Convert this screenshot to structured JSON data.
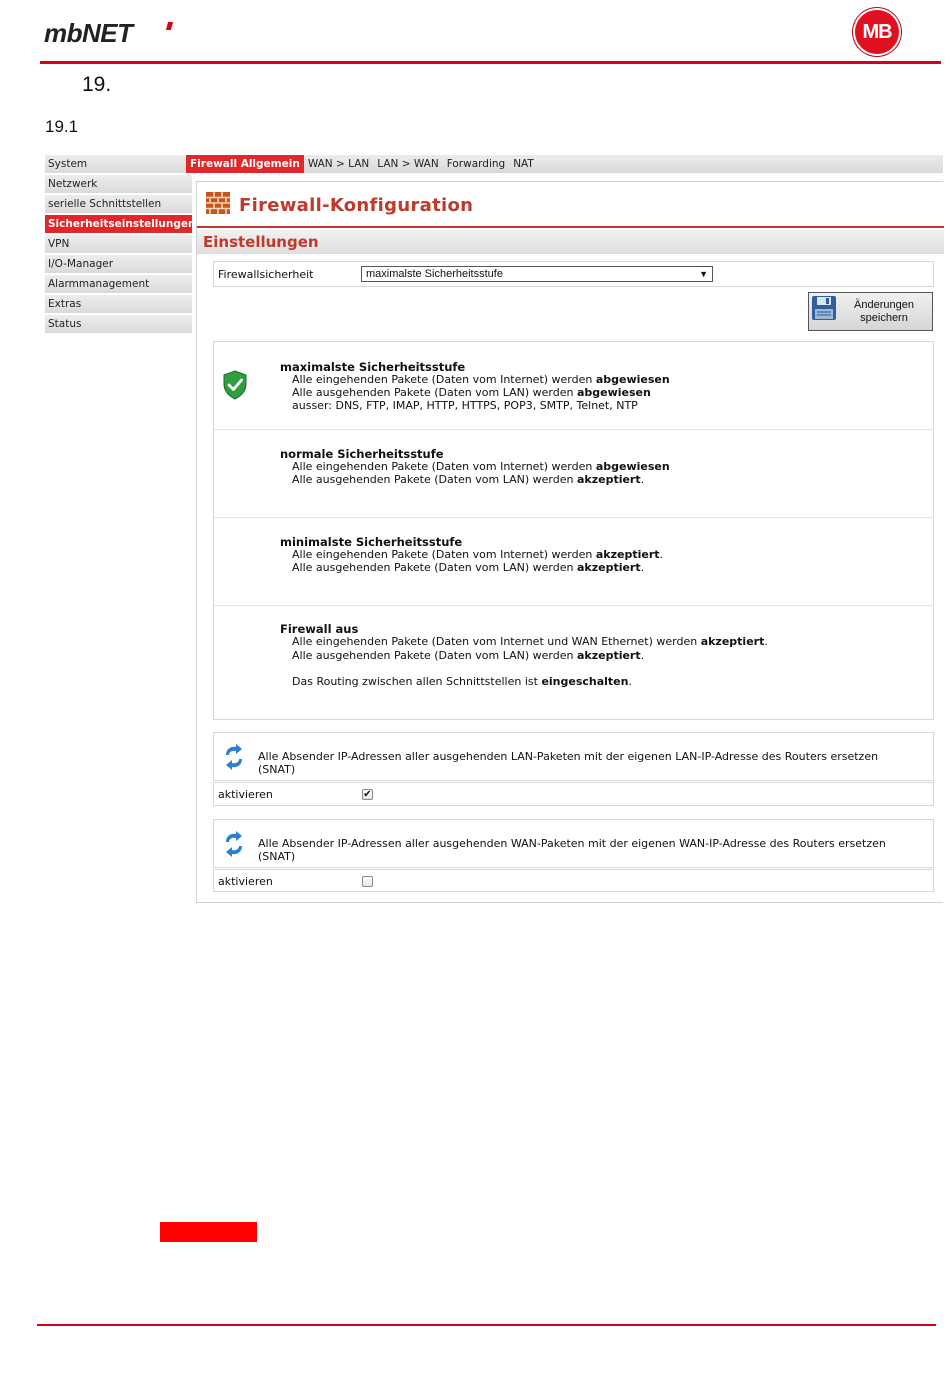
{
  "header": {
    "logo": "mbNET",
    "badge": "MB",
    "chapter": "19.",
    "section": "19.1"
  },
  "sidebar": {
    "items": [
      {
        "label": "System",
        "active": false
      },
      {
        "label": "Netzwerk",
        "active": false
      },
      {
        "label": "serielle Schnittstellen",
        "active": false
      },
      {
        "label": "Sicherheitseinstellungen",
        "active": true
      },
      {
        "label": "VPN",
        "active": false
      },
      {
        "label": "I/O-Manager",
        "active": false
      },
      {
        "label": "Alarmmanagement",
        "active": false
      },
      {
        "label": "Extras",
        "active": false
      },
      {
        "label": "Status",
        "active": false
      }
    ]
  },
  "tabs": [
    {
      "label": "Firewall Allgemein",
      "active": true
    },
    {
      "label": "WAN > LAN",
      "active": false
    },
    {
      "label": "LAN > WAN",
      "active": false
    },
    {
      "label": "Forwarding",
      "active": false
    },
    {
      "label": "NAT",
      "active": false
    }
  ],
  "main": {
    "title": "Firewall-Konfiguration",
    "subheading": "Einstellungen",
    "security_label": "Firewallsicherheit",
    "security_value": "maximalste Sicherheitsstufe",
    "save_label_1": "Änderungen",
    "save_label_2": "speichern",
    "levels": [
      {
        "title": "maximalste Sicherheitsstufe",
        "in_text": "Alle eingehenden Pakete (Daten vom Internet) werden ",
        "in_bold": "abgewiesen",
        "in_tail": "",
        "out_text": "Alle ausgehenden Pakete (Daten vom LAN) werden ",
        "out_bold": "abgewiesen",
        "out_tail": "",
        "extra": "ausser: DNS, FTP, IMAP, HTTP, HTTPS, POP3, SMTP, Telnet, NTP",
        "selected": true
      },
      {
        "title": "normale Sicherheitsstufe",
        "in_text": "Alle eingehenden Pakete (Daten vom Internet) werden ",
        "in_bold": "abgewiesen",
        "in_tail": "",
        "out_text": "Alle ausgehenden Pakete (Daten vom LAN) werden ",
        "out_bold": "akzeptiert",
        "out_tail": ".",
        "selected": false
      },
      {
        "title": "minimalste Sicherheitsstufe",
        "in_text": "Alle eingehenden Pakete (Daten vom Internet) werden ",
        "in_bold": "akzeptiert",
        "in_tail": ".",
        "out_text": "Alle ausgehenden Pakete (Daten vom LAN) werden ",
        "out_bold": "akzeptiert",
        "out_tail": ".",
        "selected": false
      },
      {
        "title": "Firewall aus",
        "in_text": "Alle eingehenden Pakete (Daten vom Internet und WAN Ethernet) werden ",
        "in_bold": "akzeptiert",
        "in_tail": ".",
        "out_text": "Alle ausgehenden Pakete (Daten vom LAN) werden ",
        "out_bold": "akzeptiert",
        "out_tail": ".",
        "routing_text": "Das Routing zwischen allen Schnittstellen ist ",
        "routing_bold": "eingeschalten",
        "routing_tail": ".",
        "selected": false
      }
    ],
    "snat_lan": {
      "text": "Alle Absender IP-Adressen aller ausgehenden LAN-Paketen mit der eigenen LAN-IP-Adresse des Routers ersetzen (SNAT)",
      "checkbox_label": "aktivieren",
      "checked": true
    },
    "snat_wan": {
      "text": "Alle Absender IP-Adressen aller ausgehenden WAN-Paketen mit der eigenen WAN-IP-Adresse des Routers ersetzen (SNAT)",
      "checkbox_label": "aktivieren",
      "checked": false
    }
  },
  "colors": {
    "brand_red": "#d8001c",
    "active_red": "#e3262a",
    "title_red": "#c0392b"
  }
}
